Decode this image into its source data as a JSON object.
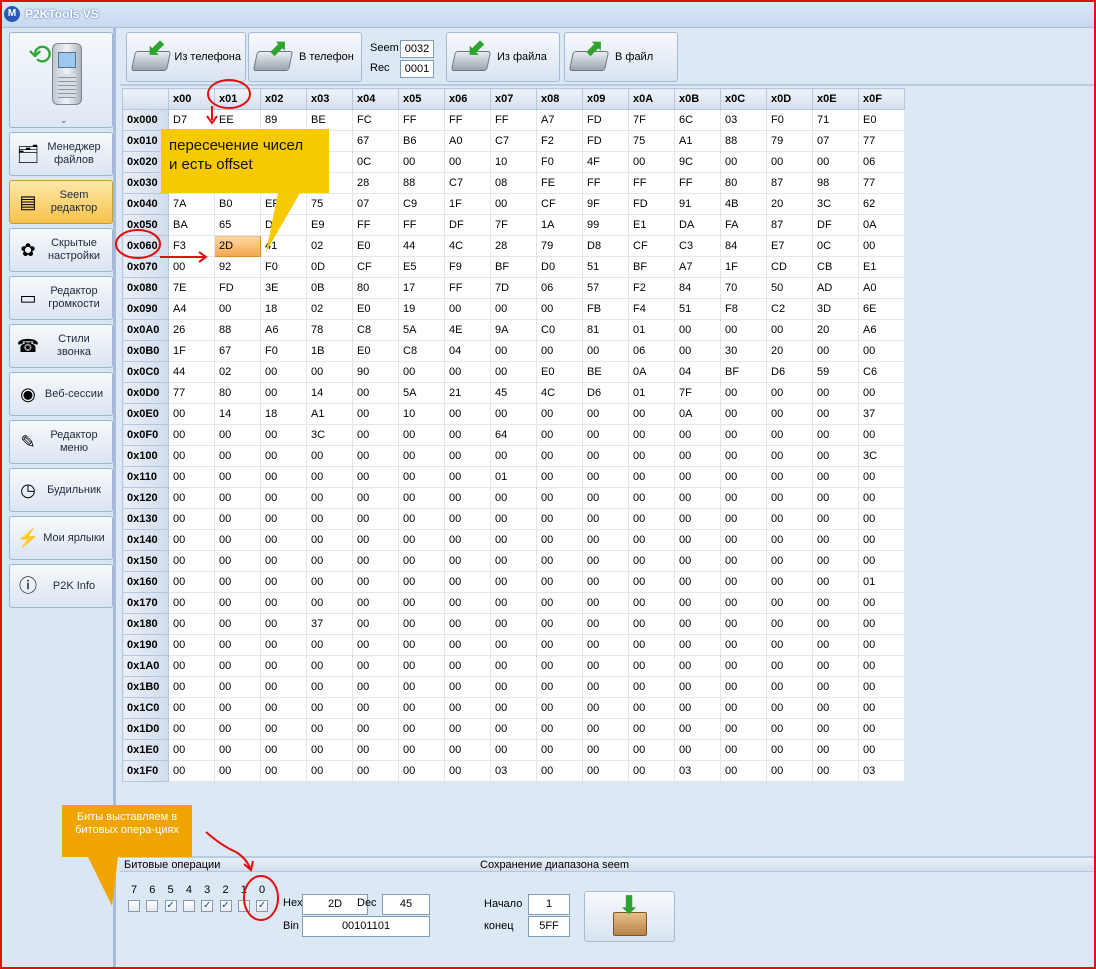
{
  "app": {
    "title": "P2KTools VS",
    "logo_letter": "M"
  },
  "sidebar": {
    "phone_chevron": "⌄",
    "items": [
      {
        "label": "Менеджер файлов",
        "icon": "file-manager-icon"
      },
      {
        "label": "Seem редактор",
        "icon": "seem-editor-icon",
        "active": true
      },
      {
        "label": "Скрытые настройки",
        "icon": "hidden-settings-icon"
      },
      {
        "label": "Редактор громкости",
        "icon": "volume-editor-icon"
      },
      {
        "label": "Стили звонка",
        "icon": "ring-styles-icon"
      },
      {
        "label": "Веб-сессии",
        "icon": "web-sessions-icon"
      },
      {
        "label": "Редактор меню",
        "icon": "menu-editor-icon"
      },
      {
        "label": "Будильник",
        "icon": "alarm-clock-icon"
      },
      {
        "label": "Мои ярлыки",
        "icon": "my-shortcuts-icon"
      },
      {
        "label": "P2K Info",
        "icon": "p2k-info-icon"
      }
    ]
  },
  "toolbar": {
    "from_phone": "Из телефона",
    "to_phone": "В телефон",
    "seem_label": "Seem",
    "seem_value": "0032",
    "rec_label": "Rec",
    "rec_value": "0001",
    "from_file": "Из файла",
    "to_file": "В файл"
  },
  "grid": {
    "columns": [
      "x00",
      "x01",
      "x02",
      "x03",
      "x04",
      "x05",
      "x06",
      "x07",
      "x08",
      "x09",
      "x0A",
      "x0B",
      "x0C",
      "x0D",
      "x0E",
      "x0F"
    ],
    "rows": [
      {
        "offset": "0x000",
        "cells": [
          "D7",
          "EE",
          "89",
          "BE",
          "FC",
          "FF",
          "FF",
          "FF",
          "A7",
          "FD",
          "7F",
          "6C",
          "03",
          "F0",
          "71",
          "E0"
        ]
      },
      {
        "offset": "0x010",
        "cells": [
          "",
          "",
          "",
          "",
          "67",
          "B6",
          "A0",
          "C7",
          "F2",
          "FD",
          "75",
          "A1",
          "88",
          "79",
          "07",
          "77"
        ]
      },
      {
        "offset": "0x020",
        "cells": [
          "",
          "",
          "",
          "",
          "0C",
          "00",
          "00",
          "10",
          "F0",
          "4F",
          "00",
          "9C",
          "00",
          "00",
          "00",
          "06"
        ]
      },
      {
        "offset": "0x030",
        "cells": [
          "",
          "",
          "",
          "",
          "28",
          "88",
          "C7",
          "08",
          "FE",
          "FF",
          "FF",
          "FF",
          "80",
          "87",
          "98",
          "77"
        ]
      },
      {
        "offset": "0x040",
        "cells": [
          "7A",
          "B0",
          "EF",
          "75",
          "07",
          "C9",
          "1F",
          "00",
          "CF",
          "9F",
          "FD",
          "91",
          "4B",
          "20",
          "3C",
          "62"
        ]
      },
      {
        "offset": "0x050",
        "cells": [
          "BA",
          "65",
          "DD",
          "E9",
          "FF",
          "FF",
          "DF",
          "7F",
          "1A",
          "99",
          "E1",
          "DA",
          "FA",
          "87",
          "DF",
          "0A"
        ]
      },
      {
        "offset": "0x060",
        "cells": [
          "F3",
          "2D",
          "41",
          "02",
          "E0",
          "44",
          "4C",
          "28",
          "79",
          "D8",
          "CF",
          "C3",
          "84",
          "E7",
          "0C",
          "00"
        ]
      },
      {
        "offset": "0x070",
        "cells": [
          "00",
          "92",
          "F0",
          "0D",
          "CF",
          "E5",
          "F9",
          "BF",
          "D0",
          "51",
          "BF",
          "A7",
          "1F",
          "CD",
          "CB",
          "E1"
        ]
      },
      {
        "offset": "0x080",
        "cells": [
          "7E",
          "FD",
          "3E",
          "0B",
          "80",
          "17",
          "FF",
          "7D",
          "06",
          "57",
          "F2",
          "84",
          "70",
          "50",
          "AD",
          "A0"
        ]
      },
      {
        "offset": "0x090",
        "cells": [
          "A4",
          "00",
          "18",
          "02",
          "E0",
          "19",
          "00",
          "00",
          "00",
          "FB",
          "F4",
          "51",
          "F8",
          "C2",
          "3D",
          "6E"
        ]
      },
      {
        "offset": "0x0A0",
        "cells": [
          "26",
          "88",
          "A6",
          "78",
          "C8",
          "5A",
          "4E",
          "9A",
          "C0",
          "81",
          "01",
          "00",
          "00",
          "00",
          "20",
          "A6"
        ]
      },
      {
        "offset": "0x0B0",
        "cells": [
          "1F",
          "67",
          "F0",
          "1B",
          "E0",
          "C8",
          "04",
          "00",
          "00",
          "00",
          "06",
          "00",
          "30",
          "20",
          "00",
          "00"
        ]
      },
      {
        "offset": "0x0C0",
        "cells": [
          "44",
          "02",
          "00",
          "00",
          "90",
          "00",
          "00",
          "00",
          "E0",
          "BE",
          "0A",
          "04",
          "BF",
          "D6",
          "59",
          "C6"
        ]
      },
      {
        "offset": "0x0D0",
        "cells": [
          "77",
          "80",
          "00",
          "14",
          "00",
          "5A",
          "21",
          "45",
          "4C",
          "D6",
          "01",
          "7F",
          "00",
          "00",
          "00",
          "00"
        ]
      },
      {
        "offset": "0x0E0",
        "cells": [
          "00",
          "14",
          "18",
          "A1",
          "00",
          "10",
          "00",
          "00",
          "00",
          "00",
          "00",
          "0A",
          "00",
          "00",
          "00",
          "37"
        ]
      },
      {
        "offset": "0x0F0",
        "cells": [
          "00",
          "00",
          "00",
          "3C",
          "00",
          "00",
          "00",
          "64",
          "00",
          "00",
          "00",
          "00",
          "00",
          "00",
          "00",
          "00"
        ]
      },
      {
        "offset": "0x100",
        "cells": [
          "00",
          "00",
          "00",
          "00",
          "00",
          "00",
          "00",
          "00",
          "00",
          "00",
          "00",
          "00",
          "00",
          "00",
          "00",
          "3C"
        ]
      },
      {
        "offset": "0x110",
        "cells": [
          "00",
          "00",
          "00",
          "00",
          "00",
          "00",
          "00",
          "01",
          "00",
          "00",
          "00",
          "00",
          "00",
          "00",
          "00",
          "00"
        ]
      },
      {
        "offset": "0x120",
        "cells": [
          "00",
          "00",
          "00",
          "00",
          "00",
          "00",
          "00",
          "00",
          "00",
          "00",
          "00",
          "00",
          "00",
          "00",
          "00",
          "00"
        ]
      },
      {
        "offset": "0x130",
        "cells": [
          "00",
          "00",
          "00",
          "00",
          "00",
          "00",
          "00",
          "00",
          "00",
          "00",
          "00",
          "00",
          "00",
          "00",
          "00",
          "00"
        ]
      },
      {
        "offset": "0x140",
        "cells": [
          "00",
          "00",
          "00",
          "00",
          "00",
          "00",
          "00",
          "00",
          "00",
          "00",
          "00",
          "00",
          "00",
          "00",
          "00",
          "00"
        ]
      },
      {
        "offset": "0x150",
        "cells": [
          "00",
          "00",
          "00",
          "00",
          "00",
          "00",
          "00",
          "00",
          "00",
          "00",
          "00",
          "00",
          "00",
          "00",
          "00",
          "00"
        ]
      },
      {
        "offset": "0x160",
        "cells": [
          "00",
          "00",
          "00",
          "00",
          "00",
          "00",
          "00",
          "00",
          "00",
          "00",
          "00",
          "00",
          "00",
          "00",
          "00",
          "01"
        ]
      },
      {
        "offset": "0x170",
        "cells": [
          "00",
          "00",
          "00",
          "00",
          "00",
          "00",
          "00",
          "00",
          "00",
          "00",
          "00",
          "00",
          "00",
          "00",
          "00",
          "00"
        ]
      },
      {
        "offset": "0x180",
        "cells": [
          "00",
          "00",
          "00",
          "37",
          "00",
          "00",
          "00",
          "00",
          "00",
          "00",
          "00",
          "00",
          "00",
          "00",
          "00",
          "00"
        ]
      },
      {
        "offset": "0x190",
        "cells": [
          "00",
          "00",
          "00",
          "00",
          "00",
          "00",
          "00",
          "00",
          "00",
          "00",
          "00",
          "00",
          "00",
          "00",
          "00",
          "00"
        ]
      },
      {
        "offset": "0x1A0",
        "cells": [
          "00",
          "00",
          "00",
          "00",
          "00",
          "00",
          "00",
          "00",
          "00",
          "00",
          "00",
          "00",
          "00",
          "00",
          "00",
          "00"
        ]
      },
      {
        "offset": "0x1B0",
        "cells": [
          "00",
          "00",
          "00",
          "00",
          "00",
          "00",
          "00",
          "00",
          "00",
          "00",
          "00",
          "00",
          "00",
          "00",
          "00",
          "00"
        ]
      },
      {
        "offset": "0x1C0",
        "cells": [
          "00",
          "00",
          "00",
          "00",
          "00",
          "00",
          "00",
          "00",
          "00",
          "00",
          "00",
          "00",
          "00",
          "00",
          "00",
          "00"
        ]
      },
      {
        "offset": "0x1D0",
        "cells": [
          "00",
          "00",
          "00",
          "00",
          "00",
          "00",
          "00",
          "00",
          "00",
          "00",
          "00",
          "00",
          "00",
          "00",
          "00",
          "00"
        ]
      },
      {
        "offset": "0x1E0",
        "cells": [
          "00",
          "00",
          "00",
          "00",
          "00",
          "00",
          "00",
          "00",
          "00",
          "00",
          "00",
          "00",
          "00",
          "00",
          "00",
          "00"
        ]
      },
      {
        "offset": "0x1F0",
        "cells": [
          "00",
          "00",
          "00",
          "00",
          "00",
          "00",
          "00",
          "03",
          "00",
          "00",
          "00",
          "03",
          "00",
          "00",
          "00",
          "03"
        ]
      }
    ],
    "selected": {
      "row": 6,
      "col": 1
    }
  },
  "bitops": {
    "title": "Битовые операции",
    "bits": [
      {
        "label": "7",
        "checked": false
      },
      {
        "label": "6",
        "checked": false
      },
      {
        "label": "5",
        "checked": true
      },
      {
        "label": "4",
        "checked": false
      },
      {
        "label": "3",
        "checked": true
      },
      {
        "label": "2",
        "checked": true
      },
      {
        "label": "1",
        "checked": false
      },
      {
        "label": "0",
        "checked": true
      }
    ],
    "hex_label": "Hex",
    "hex_value": "2D",
    "dec_label": "Dec",
    "dec_value": "45",
    "bin_label": "Bin",
    "bin_value": "00101101"
  },
  "range_save": {
    "title": "Сохранение диапазона seem",
    "start_label": "Начало",
    "start_value": "1",
    "end_label": "конец",
    "end_value": "5FF"
  },
  "annotations": {
    "callout_offset": "пересечение чисел\nи есть offset",
    "callout_bits": "Биты выставляем в битовых опера-циях"
  },
  "colors": {
    "frame": "#e01010",
    "callout": "#f7c900",
    "callout_bits": "#f0a400",
    "selected_cell": "#f4a54a",
    "active_nav": "#f6c24c"
  }
}
